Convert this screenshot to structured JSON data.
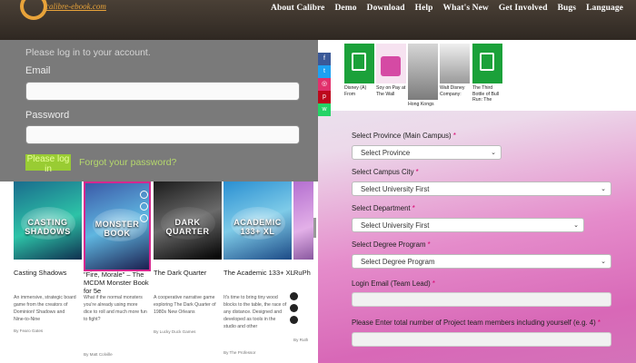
{
  "header": {
    "logo_text": "calibre-ebook.com",
    "nav": [
      "About Calibre",
      "Demo",
      "Download",
      "Help",
      "What's New",
      "Get Involved",
      "Bugs",
      "Language"
    ]
  },
  "login": {
    "intro": "Please log in to your account.",
    "email_label": "Email",
    "password_label": "Password",
    "login_button": "Please log in",
    "forgot_link": "Forgot your password?"
  },
  "books": [
    {
      "cover_title": "CASTING SHADOWS",
      "title": "Casting Shadows",
      "desc": "An immersive, strategic board game from the creators of Dominion! Shadows and Nine-to-Nine",
      "author": "By Fearo Gates",
      "colors": [
        "#1a6c8d",
        "#2dc3a7",
        "#0f2f4f"
      ]
    },
    {
      "cover_title": "MONSTER BOOK",
      "title": "\"Fire, Morale\" – The MCDM Monster Book for 5e",
      "desc": "What if the normal monsters you're already using more dice to roll and much more fun to fight?",
      "author": "By Matt Colville",
      "colors": [
        "#3b5aa8",
        "#5fb6e0",
        "#1b2050"
      ]
    },
    {
      "cover_title": "DARK QUARTER",
      "title": "The Dark Quarter",
      "desc": "A cooperative narrative game exploring The Dark Quarter of 1980s New Orleans",
      "author": "By Lucky Duck Games",
      "colors": [
        "#1c1c1c",
        "#6a6a6a",
        "#000000"
      ]
    },
    {
      "cover_title": "ACADEMIC 133+ XL",
      "title": "The Academic 133+ XL",
      "desc": "It's time to bring tiny wood blocks to the table, the race of any distance. Designed and developed as tools in the studio and other",
      "author": "By The Professor",
      "colors": [
        "#2a8fd2",
        "#7ecbe8",
        "#1c4a86"
      ]
    },
    {
      "cover_title": "",
      "title": "RuPh",
      "desc": "",
      "author": "By Ruth",
      "colors": [
        "#b46fd0",
        "#e3b0e8",
        "#5c2b7a"
      ]
    }
  ],
  "news": [
    {
      "caption": "Disney (A) From",
      "colors": [
        "#1ba13a",
        "#e9f5ec"
      ]
    },
    {
      "caption": "Soy on Pay at The Wall",
      "colors": [
        "#d54aa4",
        "#f6e2f0"
      ]
    },
    {
      "caption": "Hong Kongs",
      "colors": [
        "#7c7c7c",
        "#d6d6d6"
      ]
    },
    {
      "caption": "Walt Disney Company:",
      "colors": [
        "#9a9a9a",
        "#efefef"
      ]
    },
    {
      "caption": "The Third Bottle of Bull Run: The",
      "colors": [
        "#1ba13a",
        "#e9f5ec"
      ]
    }
  ],
  "form": {
    "province_label": "Select Province (Main Campus)",
    "province_value": "Select Province",
    "city_label": "Select Campus City",
    "city_value": "Select University First",
    "dept_label": "Select Department",
    "dept_value": "Select University First",
    "degree_label": "Select Degree Program",
    "degree_value": "Select Degree Program",
    "email_label": "Login Email (Team Lead)",
    "members_label": "Please Enter total number of Project team members including yourself (e.g. 4)",
    "required_mark": "*"
  },
  "colors": {
    "nav_bg": "#3b332c",
    "accent": "#e8a33a",
    "login_button": "#99cc33",
    "right_gradient_pink": "#e07dc3",
    "required": "#d8006d"
  }
}
